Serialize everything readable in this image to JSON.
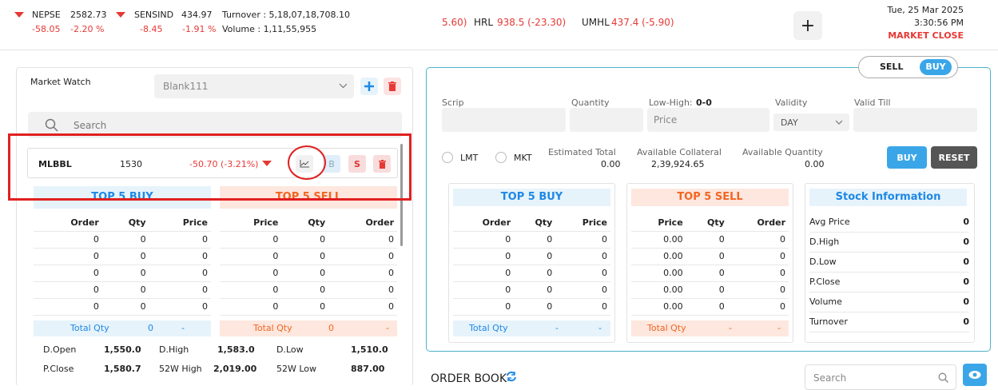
{
  "ticker": {
    "nepse": {
      "name": "NEPSE",
      "value": "2582.73",
      "change": "-58.05",
      "pct": "-2.20 %"
    },
    "sensind": {
      "name": "SENSIND",
      "value": "434.97",
      "change": "-8.45",
      "pct": "-1.91 %"
    },
    "turnover": "Turnover : 5,18,07,18,708.10",
    "volume": "Volume : 1,11,55,955",
    "scroll": {
      "lead": "5.60)",
      "hrl_name": "HRL",
      "hrl_val": "938.5 (-23.30)",
      "umhl_name": "UMHL",
      "umhl_val": "437.4 (-5.90)"
    },
    "date": "Tue, 25 Mar 2025",
    "time": "3:30:56 PM",
    "market_status": "MARKET CLOSE",
    "plus": "+"
  },
  "market_watch": {
    "label": "Market Watch",
    "selected": "Blank111",
    "search_placeholder": "Search",
    "row": {
      "symbol": "MLBBL",
      "ltp": "1530",
      "change": "-50.70 (-3.21%)",
      "b": "B",
      "s": "S"
    },
    "top_buy_title": "TOP 5 BUY",
    "top_sell_title": "TOP 5 SELL",
    "buy_headers": [
      "Order",
      "Qty",
      "Price"
    ],
    "sell_headers": [
      "Price",
      "Qty",
      "Order"
    ],
    "buy_rows": [
      [
        "0",
        "0",
        "0"
      ],
      [
        "0",
        "0",
        "0"
      ],
      [
        "0",
        "0",
        "0"
      ],
      [
        "0",
        "0",
        "0"
      ],
      [
        "0",
        "0",
        "0"
      ]
    ],
    "sell_rows": [
      [
        "0",
        "0",
        "0"
      ],
      [
        "0",
        "0",
        "0"
      ],
      [
        "0",
        "0",
        "0"
      ],
      [
        "0",
        "0",
        "0"
      ],
      [
        "0",
        "0",
        "0"
      ]
    ],
    "total_buy": [
      "Total Qty",
      "0",
      "-"
    ],
    "total_sell": [
      "Total Qty",
      "0",
      "-"
    ],
    "stats": [
      [
        "D.Open",
        "1,550.0",
        "D.High",
        "1,583.0",
        "D.Low",
        "1,510.0"
      ],
      [
        "P.Close",
        "1,580.7",
        "52W High",
        "2,019.00",
        "52W Low",
        "887.00"
      ]
    ]
  },
  "order": {
    "toggle": {
      "sell": "SELL",
      "buy": "BUY"
    },
    "labels": {
      "scrip": "Scrip",
      "quantity": "Quantity",
      "lowhigh": "Low-High:",
      "lowhigh_val": "0-0",
      "validity": "Validity",
      "valid_till": "Valid Till"
    },
    "price_placeholder": "Price",
    "validity_value": "DAY",
    "lmt": "LMT",
    "mkt": "MKT",
    "est_total_label": "Estimated Total",
    "est_total": "0.00",
    "avail_coll_label": "Available Collateral",
    "avail_coll": "2,39,924.65",
    "avail_qty_label": "Available Quantity",
    "avail_qty": "0.00",
    "buy_btn": "BUY",
    "reset_btn": "RESET",
    "top_buy_title": "TOP 5 BUY",
    "top_sell_title": "TOP 5 SELL",
    "stock_info_title": "Stock Information",
    "buy_headers": [
      "Order",
      "Qty",
      "Price"
    ],
    "sell_headers": [
      "Price",
      "Qty",
      "Order"
    ],
    "buy_rows": [
      [
        "0",
        "0",
        "0"
      ],
      [
        "0",
        "0",
        "0"
      ],
      [
        "0",
        "0",
        "0"
      ],
      [
        "0",
        "0",
        "0"
      ],
      [
        "0",
        "0",
        "0"
      ]
    ],
    "sell_rows": [
      [
        "0.00",
        "0",
        "0"
      ],
      [
        "0.00",
        "0",
        "0"
      ],
      [
        "0.00",
        "0",
        "0"
      ],
      [
        "0.00",
        "0",
        "0"
      ],
      [
        "0.00",
        "0",
        "0"
      ]
    ],
    "total_buy": [
      "Total Qty",
      "-",
      "-"
    ],
    "total_sell": [
      "Total Qty",
      "-",
      "-"
    ],
    "stock_info": [
      [
        "Avg Price",
        "0"
      ],
      [
        "D.High",
        "0"
      ],
      [
        "D.Low",
        "0"
      ],
      [
        "P.Close",
        "0"
      ],
      [
        "Volume",
        "0"
      ],
      [
        "Turnover",
        "0"
      ]
    ]
  },
  "order_book": {
    "title": "ORDER BOOK",
    "search_placeholder": "Search"
  }
}
